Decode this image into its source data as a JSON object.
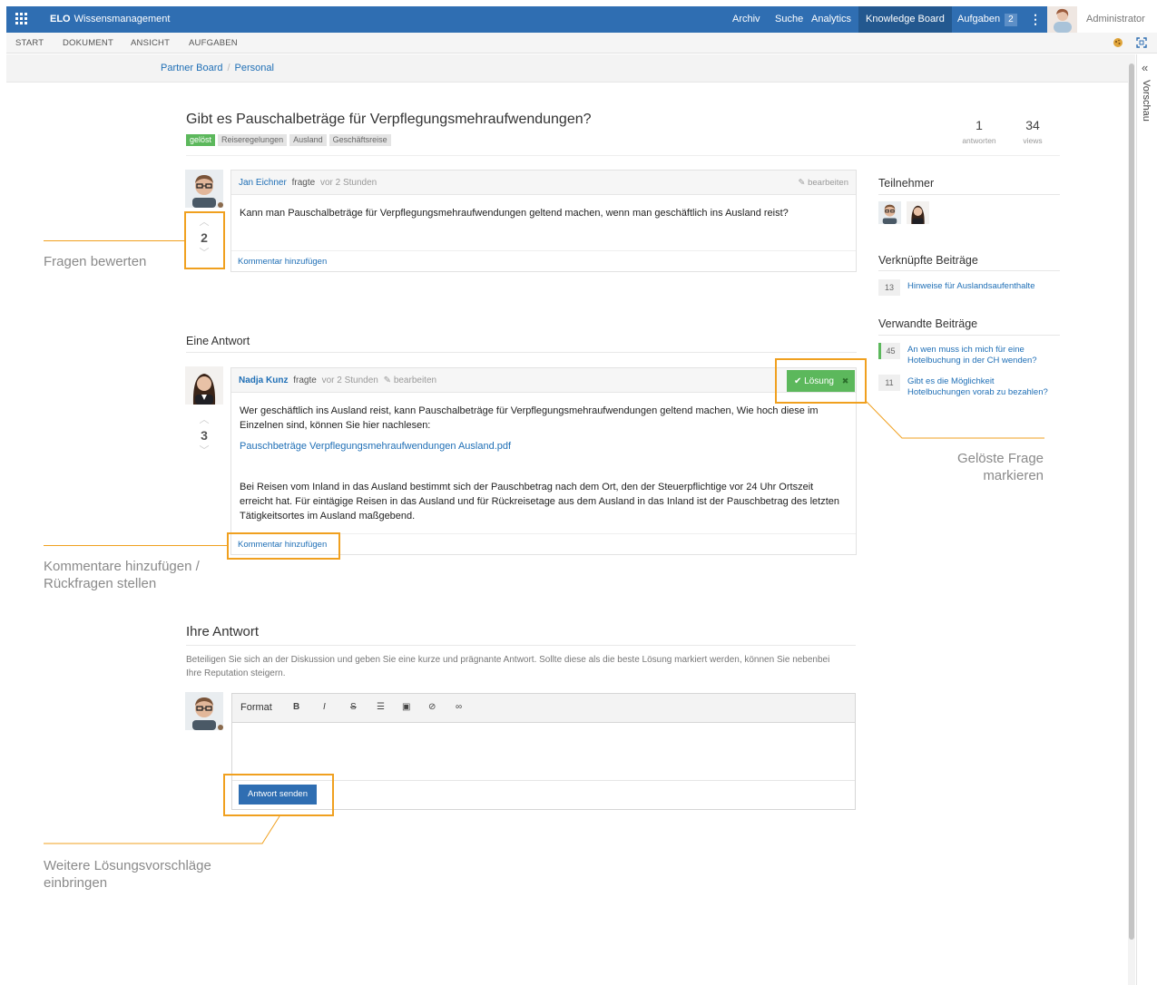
{
  "header": {
    "brand_strong": "ELO",
    "brand_name": "Wissensmanagement",
    "nav": [
      "Archiv",
      "Suche",
      "Analytics",
      "Knowledge Board"
    ],
    "tasks_label": "Aufgaben",
    "tasks_count": "2",
    "user": "Administrator"
  },
  "ribbon": [
    "START",
    "DOKUMENT",
    "ANSICHT",
    "AUFGABEN"
  ],
  "breadcrumb": [
    "Partner Board",
    "Personal"
  ],
  "preview_label": "Vorschau",
  "question": {
    "title": "Gibt es Pauschalbeträge für Verpflegungsmehraufwendungen?",
    "tags": [
      "gelöst",
      "Reiseregelungen",
      "Ausland",
      "Geschäftsreise"
    ],
    "answers_count": "1",
    "answers_label": "antworten",
    "views_count": "34",
    "views_label": "views",
    "author": "Jan Eichner",
    "verb": "fragte",
    "time": "vor 2 Stunden",
    "edit_label": "bearbeiten",
    "body": "Kann man Pauschalbeträge für Verpflegungsmehraufwendungen geltend machen, wenn man geschäftlich ins Ausland reist?",
    "votes": "2",
    "comment_label": "Kommentar hinzufügen"
  },
  "answers_heading": "Eine Antwort",
  "answer": {
    "author": "Nadja Kunz",
    "verb": "fragte",
    "time": "vor 2 Stunden",
    "edit_label": "bearbeiten",
    "solution_label": "Lösung",
    "p1": "Wer geschäftlich ins Ausland reist, kann Pauschalbeträge für Verpflegungsmehraufwendungen geltend machen, Wie hoch diese im Einzelnen sind, können Sie hier nachlesen:",
    "file_link": "Pauschbeträge Verpflegungsmehraufwendungen Ausland.pdf",
    "p2": "Bei Reisen vom Inland in das Ausland bestimmt sich der Pauschbetrag nach dem Ort, den der Steuerpflichtige vor 24 Uhr Ortszeit erreicht hat. Für eintägige Reisen in das Ausland und für Rückreisetage aus dem Ausland in das Inland ist der Pauschbetrag des letzten Tätigkeitsortes im Ausland maßgebend.",
    "votes": "3",
    "comment_label": "Kommentar hinzufügen"
  },
  "form": {
    "heading": "Ihre Antwort",
    "hint": "Beteiligen Sie sich an der Diskussion und geben Sie eine kurze und prägnante Antwort. Sollte diese als die beste Lösung markiert werden, können Sie nebenbei Ihre Reputation steigern.",
    "format_label": "Format",
    "bold": "B",
    "italic": "I",
    "submit_label": "Antwort senden"
  },
  "sidebar": {
    "participants_heading": "Teilnehmer",
    "linked_heading": "Verknüpfte Beiträge",
    "linked": [
      {
        "count": "13",
        "title": "Hinweise für Auslandsaufenthalte"
      }
    ],
    "related_heading": "Verwandte Beiträge",
    "related": [
      {
        "count": "45",
        "title_l1": "An wen muss ich mich für eine",
        "title_l2": "Hotelbuchung in der CH wenden?"
      },
      {
        "count": "11",
        "title_l1": "Gibt es die Möglichkeit",
        "title_l2": "Hotelbuchungen vorab zu bezahlen?"
      }
    ]
  },
  "callouts": {
    "rate": "Fragen bewerten",
    "solved_l1": "Gelöste Frage",
    "solved_l2": "markieren",
    "comments_l1": "Kommentare hinzufügen /",
    "comments_l2": "Rückfragen stellen",
    "more_l1": "Weitere Lösungsvorschläge",
    "more_l2": "einbringen"
  },
  "colors": {
    "primary": "#2f6eb2",
    "success": "#5cb85c",
    "callout": "#f0a01f",
    "link": "#1f6fb6"
  }
}
